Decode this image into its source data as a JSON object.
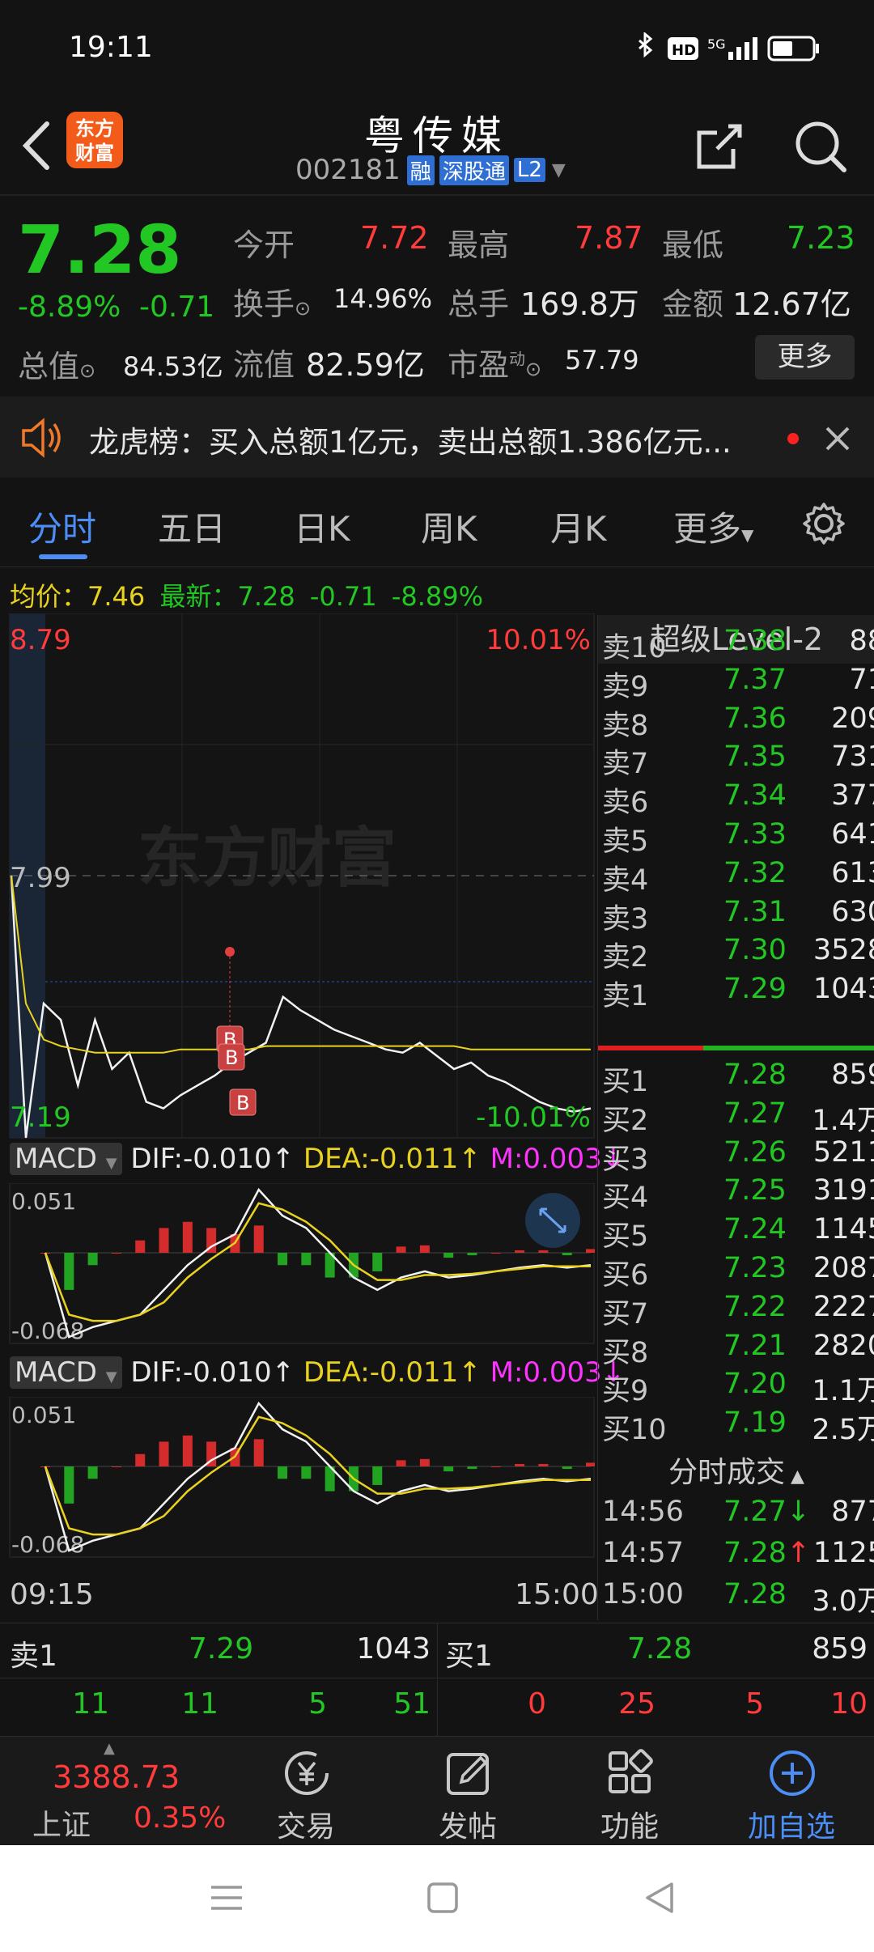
{
  "status_bar": {
    "time": "19:11",
    "network": "5G"
  },
  "header": {
    "logo_line1": "东方",
    "logo_line2": "财富",
    "stock_name": "粤传媒",
    "stock_code": "002181",
    "badges": [
      "融",
      "深股通",
      "L2"
    ]
  },
  "quote": {
    "price": "7.28",
    "change_pct": "-8.89%",
    "change": "-0.71",
    "open_label": "今开",
    "open": "7.72",
    "high_label": "最高",
    "high": "7.87",
    "low_label": "最低",
    "low": "7.23",
    "turnover_label": "换手",
    "turnover": "14.96%",
    "volume_label": "总手",
    "volume": "169.8万",
    "amount_label": "金额",
    "amount": "12.67亿",
    "mktcap_label": "总值",
    "mktcap": "84.53亿",
    "float_label": "流值",
    "float": "82.59亿",
    "pe_label": "市盈",
    "pe_sup": "动",
    "pe": "57.79",
    "more_button": "更多"
  },
  "news": {
    "text": "龙虎榜：买入总额1亿元，卖出总额1.386亿元..."
  },
  "tabs": {
    "items": [
      "分时",
      "五日",
      "日K",
      "周K",
      "月K",
      "更多"
    ],
    "active": 0
  },
  "chart_info": {
    "avg_label": "均价：",
    "avg": "7.46",
    "latest_label": "最新：",
    "latest": "7.28",
    "change": "-0.71",
    "change_pct": "-8.89%"
  },
  "chart_data": [
    {
      "type": "line",
      "title": "分时",
      "y_labels": {
        "top": "8.79",
        "mid": "7.99",
        "bottom": "7.19"
      },
      "pct_labels": {
        "top": "10.01%",
        "bottom": "-10.01%"
      },
      "ylim": [
        7.19,
        8.79
      ],
      "prev_close": 7.99,
      "x_labels": [
        "09:15",
        "15:00"
      ],
      "watermark": "东方财富",
      "markers": [
        "B",
        "B",
        "B"
      ],
      "series": [
        {
          "name": "price",
          "values": [
            7.99,
            7.19,
            7.6,
            7.55,
            7.35,
            7.55,
            7.4,
            7.45,
            7.3,
            7.28,
            7.32,
            7.35,
            7.38,
            7.42,
            7.45,
            7.48,
            7.62,
            7.58,
            7.55,
            7.52,
            7.5,
            7.48,
            7.46,
            7.45,
            7.48,
            7.44,
            7.4,
            7.42,
            7.38,
            7.36,
            7.33,
            7.3,
            7.28,
            7.27,
            7.28
          ]
        },
        {
          "name": "avg",
          "values": [
            7.99,
            7.6,
            7.49,
            7.47,
            7.46,
            7.45,
            7.45,
            7.45,
            7.45,
            7.45,
            7.46,
            7.46,
            7.46,
            7.46,
            7.46,
            7.47,
            7.47,
            7.47,
            7.47,
            7.47,
            7.47,
            7.47,
            7.47,
            7.47,
            7.47,
            7.47,
            7.47,
            7.46,
            7.46,
            7.46,
            7.46,
            7.46,
            7.46,
            7.46,
            7.46
          ]
        }
      ]
    },
    {
      "type": "line",
      "title": "MACD",
      "indicator_label": "MACD",
      "dif_label": "DIF:",
      "dif": "-0.010",
      "dea_label": "DEA:",
      "dea": "-0.011",
      "m_label": "M:",
      "m": "0.003",
      "y_labels": {
        "top": "0.051",
        "bottom": "-0.068"
      },
      "ylim": [
        -0.068,
        0.051
      ],
      "series": [
        {
          "name": "DIF",
          "values": [
            0.0,
            -0.068,
            -0.06,
            -0.055,
            -0.05,
            -0.03,
            -0.01,
            0.005,
            0.015,
            0.051,
            0.03,
            0.02,
            0.0,
            -0.02,
            -0.03,
            -0.02,
            -0.015,
            -0.02,
            -0.018,
            -0.015,
            -0.012,
            -0.01,
            -0.012,
            -0.01
          ]
        },
        {
          "name": "DEA",
          "values": [
            0.0,
            -0.05,
            -0.055,
            -0.055,
            -0.05,
            -0.04,
            -0.02,
            -0.005,
            0.008,
            0.04,
            0.035,
            0.025,
            0.01,
            -0.01,
            -0.022,
            -0.022,
            -0.018,
            -0.018,
            -0.017,
            -0.015,
            -0.013,
            -0.011,
            -0.011,
            -0.011
          ]
        },
        {
          "name": "M",
          "values": [
            0.0,
            -0.03,
            -0.01,
            0.0,
            0.01,
            0.02,
            0.025,
            0.02,
            0.015,
            0.022,
            -0.01,
            -0.01,
            -0.02,
            -0.02,
            -0.015,
            0.005,
            0.006,
            -0.004,
            -0.002,
            0.0,
            0.002,
            0.002,
            -0.002,
            0.003
          ]
        }
      ]
    }
  ],
  "orderbook": {
    "title": "超级Level-2",
    "asks": [
      {
        "label": "卖10",
        "price": "7.38",
        "vol": "88"
      },
      {
        "label": "卖9",
        "price": "7.37",
        "vol": "71"
      },
      {
        "label": "卖8",
        "price": "7.36",
        "vol": "209"
      },
      {
        "label": "卖7",
        "price": "7.35",
        "vol": "731"
      },
      {
        "label": "卖6",
        "price": "7.34",
        "vol": "377"
      },
      {
        "label": "卖5",
        "price": "7.33",
        "vol": "641"
      },
      {
        "label": "卖4",
        "price": "7.32",
        "vol": "613"
      },
      {
        "label": "卖3",
        "price": "7.31",
        "vol": "630"
      },
      {
        "label": "卖2",
        "price": "7.30",
        "vol": "3528"
      },
      {
        "label": "卖1",
        "price": "7.29",
        "vol": "1043"
      }
    ],
    "bids": [
      {
        "label": "买1",
        "price": "7.28",
        "vol": "859"
      },
      {
        "label": "买2",
        "price": "7.27",
        "vol": "1.4万"
      },
      {
        "label": "买3",
        "price": "7.26",
        "vol": "5211"
      },
      {
        "label": "买4",
        "price": "7.25",
        "vol": "3191"
      },
      {
        "label": "买5",
        "price": "7.24",
        "vol": "1145"
      },
      {
        "label": "买6",
        "price": "7.23",
        "vol": "2087"
      },
      {
        "label": "买7",
        "price": "7.22",
        "vol": "2227"
      },
      {
        "label": "买8",
        "price": "7.21",
        "vol": "2820"
      },
      {
        "label": "买9",
        "price": "7.20",
        "vol": "1.1万"
      },
      {
        "label": "买10",
        "price": "7.19",
        "vol": "2.5万"
      }
    ],
    "ticks_title": "分时成交",
    "ticks": [
      {
        "time": "14:56",
        "price": "7.27",
        "arrow": "↓",
        "vol": "877"
      },
      {
        "time": "14:57",
        "price": "7.28",
        "arrow": "↑",
        "vol": "1125"
      },
      {
        "time": "15:00",
        "price": "7.28",
        "arrow": "",
        "vol": "3.0万"
      }
    ]
  },
  "bottom_quote": {
    "sell_label": "卖1",
    "sell_price": "7.29",
    "sell_vol": "1043",
    "buy_label": "买1",
    "buy_price": "7.28",
    "buy_vol": "859",
    "sell_queue": [
      "11",
      "11",
      "5",
      "51"
    ],
    "buy_queue": [
      "0",
      "25",
      "5",
      "10"
    ]
  },
  "navbar": {
    "index_value": "3388.73",
    "index_name": "上证",
    "index_change": "0.35%",
    "items": [
      "交易",
      "发帖",
      "功能",
      "加自选"
    ]
  }
}
